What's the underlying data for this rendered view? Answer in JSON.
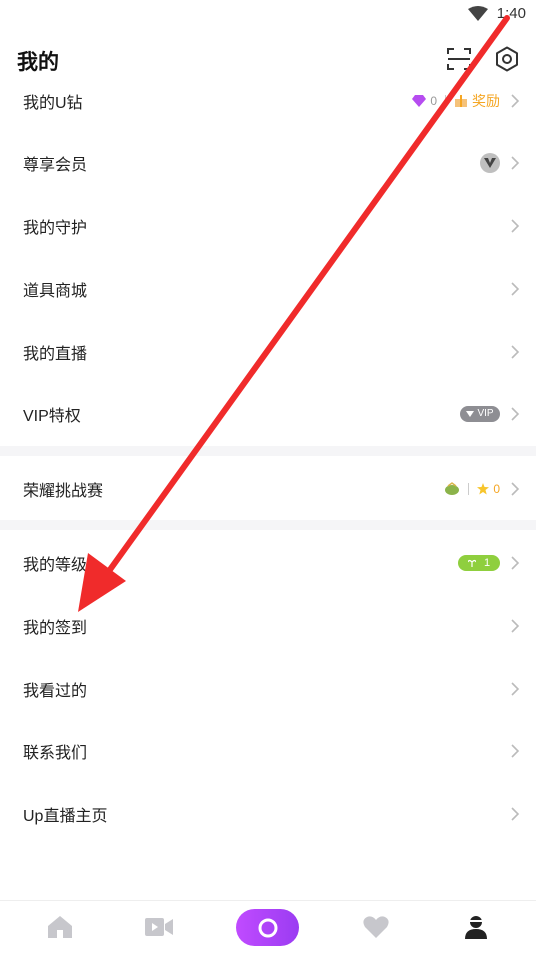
{
  "status": {
    "time": "1:40"
  },
  "header": {
    "title": "我的"
  },
  "menu": [
    {
      "label": "我的U钻",
      "diamonds": "0",
      "reward": "奖励"
    },
    {
      "label": "尊享会员"
    },
    {
      "label": "我的守护"
    },
    {
      "label": "道具商城"
    },
    {
      "label": "我的直播"
    },
    {
      "label": "VIP特权",
      "badge": "VIP"
    },
    {
      "label": "荣耀挑战赛",
      "stars": "0"
    },
    {
      "label": "我的等级",
      "level": "1"
    },
    {
      "label": "我的签到"
    },
    {
      "label": "我看过的"
    },
    {
      "label": "联系我们"
    },
    {
      "label": "Up直播主页"
    }
  ],
  "colors": {
    "accent": "#a53ff5",
    "reward": "#f5a623",
    "level": "#8fcf3e",
    "arrow": "#f02b2b"
  },
  "icons": [
    "wifi-icon",
    "scan-icon",
    "gear-icon",
    "chevron-right-icon",
    "home-icon",
    "video-icon",
    "live-icon",
    "heart-icon",
    "profile-icon"
  ]
}
